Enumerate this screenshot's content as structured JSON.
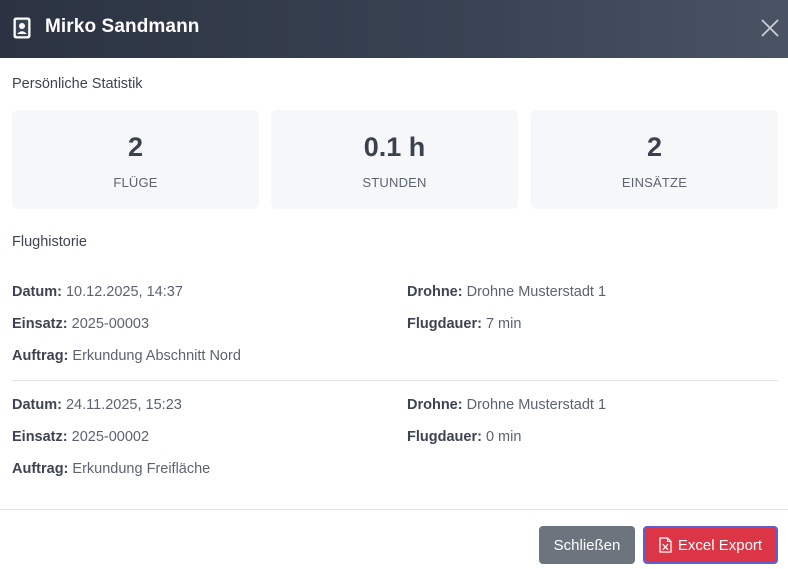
{
  "dialog": {
    "title": "Mirko Sandmann",
    "title_icon": "id-badge-icon",
    "close_icon": "close-icon"
  },
  "stats": {
    "section_title": "Persönliche Statistik",
    "cards": [
      {
        "value": "2",
        "label": "FLÜGE"
      },
      {
        "value": "0.1 h",
        "label": "STUNDEN"
      },
      {
        "value": "2",
        "label": "EINSÄTZE"
      }
    ]
  },
  "history": {
    "section_title": "Flughistorie",
    "entries": [
      {
        "datum_label": "Datum:",
        "datum": "10.12.2025, 14:37",
        "einsatz_label": "Einsatz:",
        "einsatz": "2025-00003",
        "auftrag_label": "Auftrag:",
        "auftrag": "Erkundung Abschnitt Nord",
        "drohne_label": "Drohne:",
        "drohne": "Drohne Musterstadt 1",
        "flugdauer_label": "Flugdauer:",
        "flugdauer": "7 min"
      },
      {
        "datum_label": "Datum:",
        "datum": "24.11.2025, 15:23",
        "einsatz_label": "Einsatz:",
        "einsatz": "2025-00002",
        "auftrag_label": "Auftrag:",
        "auftrag": "Erkundung Freifläche",
        "drohne_label": "Drohne:",
        "drohne": "Drohne Musterstadt 1",
        "flugdauer_label": "Flugdauer:",
        "flugdauer": "0 min"
      }
    ]
  },
  "footer": {
    "close_label": "Schließen",
    "export_label": "Excel Export",
    "export_icon": "file-excel-icon"
  },
  "colors": {
    "header_bg": "#2b3342",
    "close_button": "#6c757d",
    "export_button": "#dc3545"
  }
}
